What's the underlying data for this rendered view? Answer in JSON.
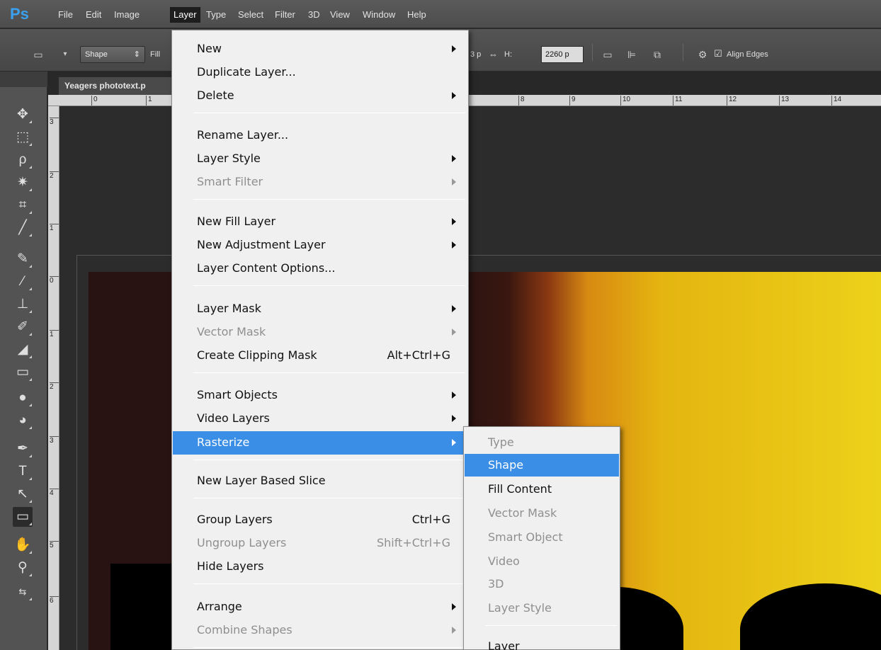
{
  "app": {
    "logo": "Ps"
  },
  "menubar": {
    "items": [
      "File",
      "Edit",
      "Image",
      "Layer",
      "Type",
      "Select",
      "Filter",
      "3D",
      "View",
      "Window",
      "Help"
    ],
    "active": "Layer"
  },
  "options": {
    "mode": "Shape",
    "fill_label": "Fill",
    "width_value": "3 p",
    "height_label": "H:",
    "height_value": "2260 p",
    "align_edges": "Align Edges",
    "link_icon": "link-icon"
  },
  "document": {
    "tab_title": "Yeagers phototext.p",
    "ruler_top": [
      "0",
      "1",
      "8",
      "9",
      "10",
      "11",
      "12",
      "13",
      "14"
    ],
    "ruler_left": [
      "3",
      "2",
      "1",
      "0",
      "1",
      "2",
      "3",
      "4",
      "5",
      "6"
    ]
  },
  "layer_menu": {
    "new": "New",
    "duplicate": "Duplicate Layer...",
    "delete": "Delete",
    "rename": "Rename Layer...",
    "layer_style": "Layer Style",
    "smart_filter": "Smart Filter",
    "new_fill": "New Fill Layer",
    "new_adjustment": "New Adjustment Layer",
    "content_options": "Layer Content Options...",
    "layer_mask": "Layer Mask",
    "vector_mask": "Vector Mask",
    "clipping_mask": "Create Clipping Mask",
    "clipping_mask_shortcut": "Alt+Ctrl+G",
    "smart_objects": "Smart Objects",
    "video_layers": "Video Layers",
    "rasterize": "Rasterize",
    "new_slice": "New Layer Based Slice",
    "group": "Group Layers",
    "group_shortcut": "Ctrl+G",
    "ungroup": "Ungroup Layers",
    "ungroup_shortcut": "Shift+Ctrl+G",
    "hide": "Hide Layers",
    "arrange": "Arrange",
    "combine": "Combine Shapes"
  },
  "rasterize_menu": {
    "type": "Type",
    "shape": "Shape",
    "fill_content": "Fill Content",
    "vector_mask": "Vector Mask",
    "smart_object": "Smart Object",
    "video": "Video",
    "three_d": "3D",
    "layer_style": "Layer Style",
    "layer": "Layer"
  },
  "colors": {
    "menu_highlight": "#3a8ee6",
    "ps_blue": "#3aa0f0",
    "ui_dark": "#535353"
  }
}
